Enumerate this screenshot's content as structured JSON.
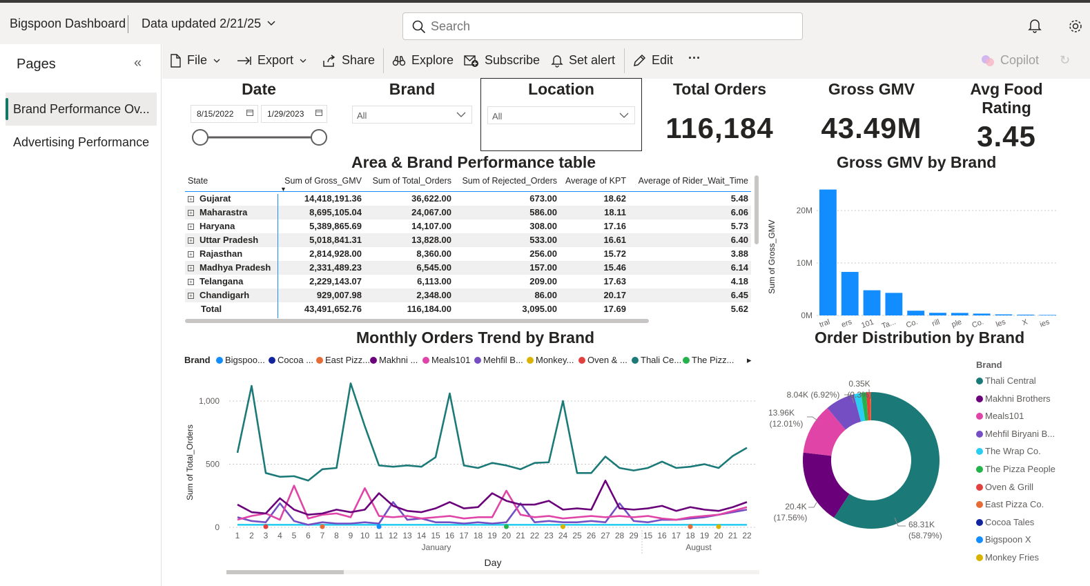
{
  "app": {
    "title": "Bigspoon Dashboard",
    "updated": "Data updated 2/21/25",
    "search_placeholder": "Search"
  },
  "pages_panel": {
    "header": "Pages",
    "collapse_glyph": "«",
    "items": [
      {
        "label": "Brand Performance Ov...",
        "active": true
      },
      {
        "label": "Advertising Performance",
        "active": false
      }
    ]
  },
  "toolbar": {
    "file": "File",
    "export": "Export",
    "share": "Share",
    "explore": "Explore",
    "subscribe": "Subscribe",
    "set_alert": "Set alert",
    "edit": "Edit",
    "more": "···",
    "copilot": "Copilot"
  },
  "slicers": {
    "date": {
      "title": "Date",
      "start": "8/15/2022",
      "end": "1/29/2023"
    },
    "brand": {
      "title": "Brand",
      "value": "All"
    },
    "location": {
      "title": "Location",
      "value": "All"
    }
  },
  "cards": [
    {
      "title": "Total Orders",
      "value": "116,184"
    },
    {
      "title": "Gross GMV",
      "value": "43.49M"
    },
    {
      "title": "Avg Food Rating",
      "value": "3.45"
    }
  ],
  "table": {
    "title": "Area & Brand Performance table",
    "columns": [
      "State",
      "Sum of Gross_GMV",
      "Sum of Total_Orders",
      "Sum of Rejected_Orders",
      "Average of KPT",
      "Average of Rider_Wait_Time"
    ],
    "rows": [
      [
        "Gujarat",
        "14,418,191.36",
        "36,622.00",
        "673.00",
        "18.62",
        "5.48"
      ],
      [
        "Maharastra",
        "8,695,105.04",
        "24,067.00",
        "586.00",
        "18.11",
        "6.06"
      ],
      [
        "Haryana",
        "5,389,865.69",
        "14,107.00",
        "308.00",
        "17.16",
        "5.73"
      ],
      [
        "Uttar Pradesh",
        "5,018,841.31",
        "13,828.00",
        "533.00",
        "16.61",
        "6.40"
      ],
      [
        "Rajasthan",
        "2,814,928.00",
        "8,360.00",
        "256.00",
        "15.72",
        "3.88"
      ],
      [
        "Madhya Pradesh",
        "2,331,489.23",
        "6,545.00",
        "157.00",
        "15.46",
        "6.14"
      ],
      [
        "Telangana",
        "2,229,143.07",
        "6,113.00",
        "209.00",
        "17.63",
        "4.18"
      ],
      [
        "Chandigarh",
        "929,007.98",
        "2,348.00",
        "86.00",
        "20.17",
        "6.45"
      ]
    ],
    "total": [
      "Total",
      "43,491,652.76",
      "116,184.00",
      "3,095.00",
      "17.69",
      "5.62"
    ]
  },
  "colors": {
    "thali": "#1b7a78",
    "makhni": "#6b007b",
    "meals": "#e044a7",
    "mehfil": "#744ec2",
    "wrap": "#2bcdf0",
    "pizza_people": "#26b24a",
    "oven": "#e3413f",
    "east": "#e66c37",
    "cocoa": "#12239e",
    "bigspoon": "#118dff",
    "monkey": "#d9b300",
    "bar": "#118dff"
  },
  "chart_data": [
    {
      "type": "bar",
      "title": "Gross GMV by Brand",
      "ylabel": "Sum of Gross_GMV",
      "ylim": [
        0,
        25000000
      ],
      "yticks": [
        "0M",
        "10M",
        "20M"
      ],
      "categories": [
        "...tral",
        "...ers",
        "...101",
        "...Ta...",
        "...Co.",
        "...rill",
        "...ple",
        "...Co.",
        "...les",
        "...X",
        "...ies"
      ],
      "values": [
        24000000,
        8300000,
        4800000,
        4300000,
        900000,
        500000,
        480000,
        350000,
        200000,
        150000,
        100000
      ]
    },
    {
      "type": "line",
      "title": "Monthly Orders Trend by Brand",
      "xlabel": "Day",
      "ylabel": "Sum of Total_Orders",
      "ylim": [
        0,
        1200
      ],
      "yticks": [
        "0",
        "500",
        "1,000"
      ],
      "legend_title": "Brand",
      "legend": [
        "Bigspoo...",
        "Cocoa ...",
        "East Pizz...",
        "Makhni ...",
        "Meals101",
        "Mehfil B...",
        "Monkey...",
        "Oven & ...",
        "Thali Ce...",
        "The Pizz..."
      ],
      "x": [
        "1",
        "2",
        "3",
        "4",
        "5",
        "6",
        "7",
        "8",
        "9",
        "10",
        "11",
        "12",
        "13",
        "14",
        "15",
        "16",
        "17",
        "18",
        "19",
        "20",
        "21",
        "22",
        "23",
        "24",
        "25",
        "26",
        "27",
        "28",
        "29",
        "15",
        "16",
        "17",
        "18",
        "19",
        "20",
        "21",
        "22"
      ],
      "month_labels": [
        "January",
        "August"
      ],
      "series": [
        {
          "name": "Thali Ce...",
          "color_key": "thali",
          "values": [
            590,
            1120,
            430,
            400,
            405,
            370,
            460,
            470,
            1140,
            800,
            490,
            480,
            490,
            480,
            555,
            1060,
            490,
            470,
            510,
            490,
            460,
            510,
            515,
            1000,
            430,
            430,
            560,
            470,
            450,
            470,
            520,
            470,
            480,
            500,
            470,
            565,
            630,
            460
          ]
        },
        {
          "name": "Makhni ...",
          "color_key": "makhni",
          "values": [
            180,
            120,
            110,
            230,
            140,
            100,
            110,
            140,
            120,
            140,
            270,
            170,
            130,
            120,
            150,
            200,
            150,
            160,
            270,
            210,
            180,
            180,
            210,
            140,
            150,
            140,
            370,
            150,
            140,
            150,
            170,
            130,
            160,
            140,
            130,
            160,
            200,
            120
          ]
        },
        {
          "name": "Meals101",
          "color_key": "meals",
          "values": [
            60,
            90,
            110,
            60,
            330,
            70,
            100,
            110,
            80,
            310,
            90,
            80,
            90,
            70,
            80,
            90,
            70,
            80,
            80,
            290,
            100,
            80,
            90,
            70,
            80,
            90,
            80,
            90,
            80,
            90,
            70,
            60,
            80,
            90,
            100,
            130,
            160,
            80
          ]
        },
        {
          "name": "Mehfil B...",
          "color_key": "mehfil",
          "values": [
            80,
            50,
            40,
            190,
            50,
            20,
            40,
            30,
            30,
            40,
            30,
            200,
            60,
            70,
            40,
            40,
            30,
            40,
            30,
            40,
            190,
            40,
            50,
            40,
            40,
            50,
            40,
            190,
            50,
            40,
            60,
            60,
            70,
            80,
            100,
            120,
            140,
            80
          ]
        },
        {
          "name": "The Wrap Co.",
          "color_key": "wrap",
          "values": [
            20,
            20,
            20,
            20,
            20,
            20,
            20,
            20,
            20,
            20,
            20,
            20,
            20,
            20,
            20,
            20,
            20,
            20,
            20,
            20,
            20,
            20,
            20,
            20,
            20,
            20,
            20,
            20,
            20,
            20,
            20,
            20,
            20,
            20,
            20,
            20,
            20,
            20
          ]
        }
      ]
    },
    {
      "type": "pie",
      "title": "Order Distribution by Brand",
      "legend_title": "Brand",
      "legend": [
        "Thali Central",
        "Makhni Brothers",
        "Meals101",
        "Mehfil Biryani B...",
        "The Wrap Co.",
        "The Pizza People",
        "Oven & Grill",
        "East Pizza Co.",
        "Cocoa Tales",
        "Bigspoon X",
        "Monkey Fries"
      ],
      "slices": [
        {
          "name": "Thali Central",
          "value": 68310,
          "percent": 58.79,
          "color_key": "thali"
        },
        {
          "name": "Makhni Brothers",
          "value": 20400,
          "percent": 17.56,
          "color_key": "makhni"
        },
        {
          "name": "Meals101",
          "value": 13960,
          "percent": 12.01,
          "color_key": "meals"
        },
        {
          "name": "Mehfil Biryani B...",
          "value": 8040,
          "percent": 6.92,
          "color_key": "mehfil"
        },
        {
          "name": "The Wrap Co.",
          "value": 2000,
          "percent": 1.72,
          "color_key": "wrap"
        },
        {
          "name": "The Pizza People",
          "value": 1400,
          "percent": 1.2,
          "color_key": "pizza_people"
        },
        {
          "name": "Oven & Grill",
          "value": 1000,
          "percent": 0.86,
          "color_key": "oven"
        },
        {
          "name": "East Pizza Co.",
          "value": 350,
          "percent": 0.3,
          "color_key": "east"
        }
      ],
      "labels": [
        {
          "value": "68.31K",
          "pct": "(58.79%)"
        },
        {
          "value": "20.4K",
          "pct": "(17.56%)"
        },
        {
          "value": "13.96K",
          "pct": "(12.01%)"
        },
        {
          "value": "8.04K (6.92%)",
          "pct": ""
        },
        {
          "value": "0.35K",
          "pct": "(0.3%)"
        }
      ]
    }
  ]
}
